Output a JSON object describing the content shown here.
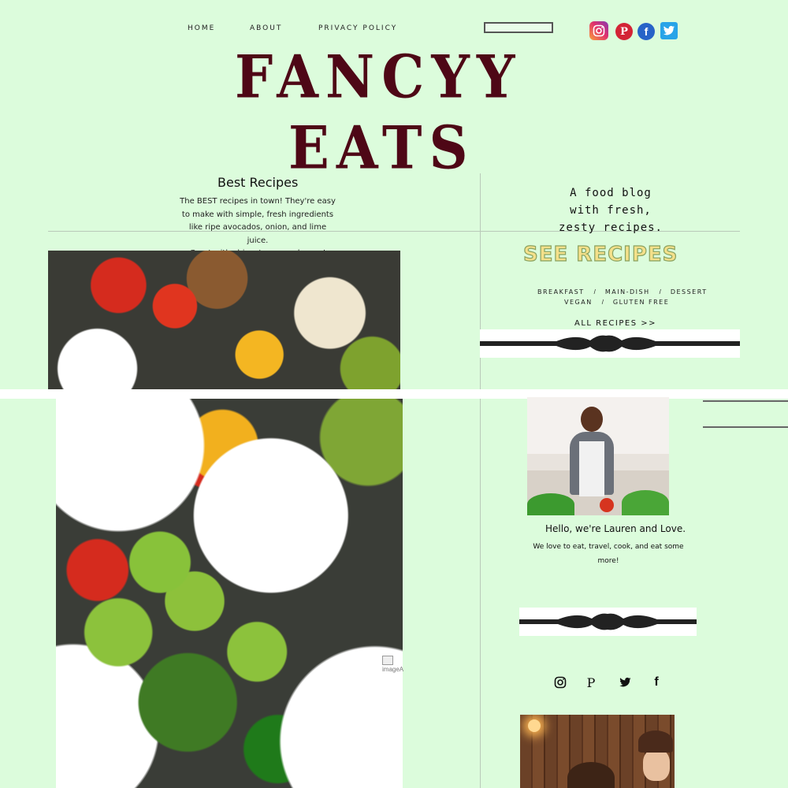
{
  "nav": {
    "items": [
      "HOME",
      "ABOUT",
      "PRIVACY POLICY"
    ]
  },
  "search": {
    "placeholder": ""
  },
  "social_top": {
    "pinterest_glyph": "P",
    "facebook_glyph": "f"
  },
  "brand": {
    "line1": "FANCYY",
    "line2": "EATS",
    "color": "#4e0716"
  },
  "intro": {
    "heading": "Best Recipes",
    "lines": [
      "The BEST recipes in town! They're easy",
      "to make with simple, fresh ingredients",
      "like ripe avocados, onion, and lime juice.",
      "Great with chips, tacos, and more!"
    ]
  },
  "sidebar": {
    "tagline": [
      "A food blog",
      "with fresh,",
      "zesty recipes."
    ],
    "see_recipes": "SEE RECIPES",
    "categories_row1": [
      "BREAKFAST",
      "MAIN-DISH",
      "DESSERT"
    ],
    "categories_row2": [
      "VEGAN",
      "GLUTEN FREE"
    ],
    "separator": "/",
    "all_recipes": "ALL RECIPES >>",
    "hello": "Hello, we're Lauren and Love.",
    "bio": "We love to eat, travel, cook, and eat some more!",
    "social_glyphs": {
      "pinterest": "P",
      "facebook": "f"
    }
  },
  "images": {
    "broken_alt": "imageA"
  },
  "colors": {
    "background": "#dcfcdc",
    "see_recipes_fill": "#f4e08a",
    "instagram": "#e1306c",
    "pinterest": "#d32336",
    "facebook": "#2763c8",
    "twitter": "#28a4e8"
  }
}
